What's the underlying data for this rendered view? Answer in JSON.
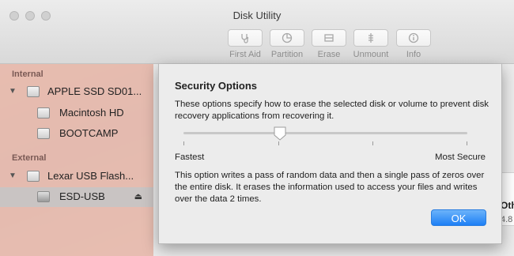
{
  "window": {
    "title": "Disk Utility"
  },
  "toolbar": [
    {
      "label": "First Aid",
      "icon": "stethoscope-icon"
    },
    {
      "label": "Partition",
      "icon": "pie-chart-icon"
    },
    {
      "label": "Erase",
      "icon": "eraser-icon"
    },
    {
      "label": "Unmount",
      "icon": "unmount-icon"
    },
    {
      "label": "Info",
      "icon": "info-icon"
    }
  ],
  "sidebar": {
    "internal_label": "Internal",
    "external_label": "External",
    "items": [
      {
        "label": "APPLE SSD SD01...",
        "kind": "disk"
      },
      {
        "label": "Macintosh HD",
        "kind": "volume"
      },
      {
        "label": "BOOTCAMP",
        "kind": "volume"
      },
      {
        "label": "Lexar USB Flash...",
        "kind": "disk"
      },
      {
        "label": "ESD-USB",
        "kind": "volume",
        "selected": true
      }
    ]
  },
  "content_peek": {
    "heading": "Oth",
    "value": "4.8"
  },
  "dialog": {
    "title": "Security Options",
    "description": "These options specify how to erase the selected disk or volume to prevent disk recovery applications from recovering it.",
    "slider": {
      "min_label": "Fastest",
      "max_label": "Most Secure",
      "steps": 4,
      "position": 1
    },
    "info": "This option writes a pass of random data and then a single pass of zeros over the entire disk. It erases the information used to access your files and writes over the data 2 times.",
    "ok_label": "OK"
  },
  "colors": {
    "accent": "#1d7ff5",
    "sidebar_bg": "#f0cdc3"
  }
}
